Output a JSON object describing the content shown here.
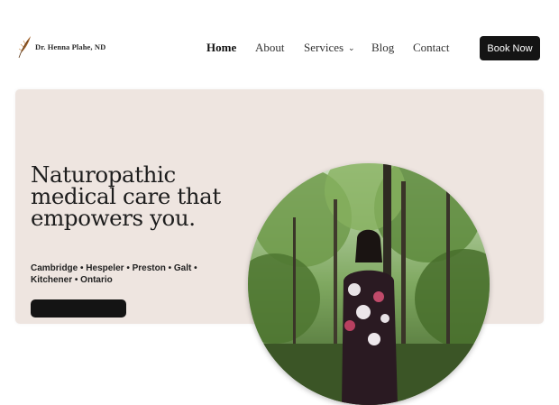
{
  "header": {
    "logo_text": "Dr. Henna Plahe, ND",
    "logo_icon": "feather-icon",
    "nav": [
      {
        "label": "Home"
      },
      {
        "label": "About"
      },
      {
        "label": "Services"
      },
      {
        "label": "Blog"
      },
      {
        "label": "Contact"
      }
    ],
    "services_chevron": "chevron-down-icon",
    "book_label": "Book Now"
  },
  "hero": {
    "headline": "Naturopathic medical care that empowers you.",
    "locations": "Cambridge • Hespeler • Preston • Galt • Kitchener • Ontario",
    "photo": "portrait-in-forest"
  },
  "colors": {
    "hero_bg": "#eee5e0",
    "button_bg": "#141414",
    "text_dark": "#1d1d1d"
  }
}
